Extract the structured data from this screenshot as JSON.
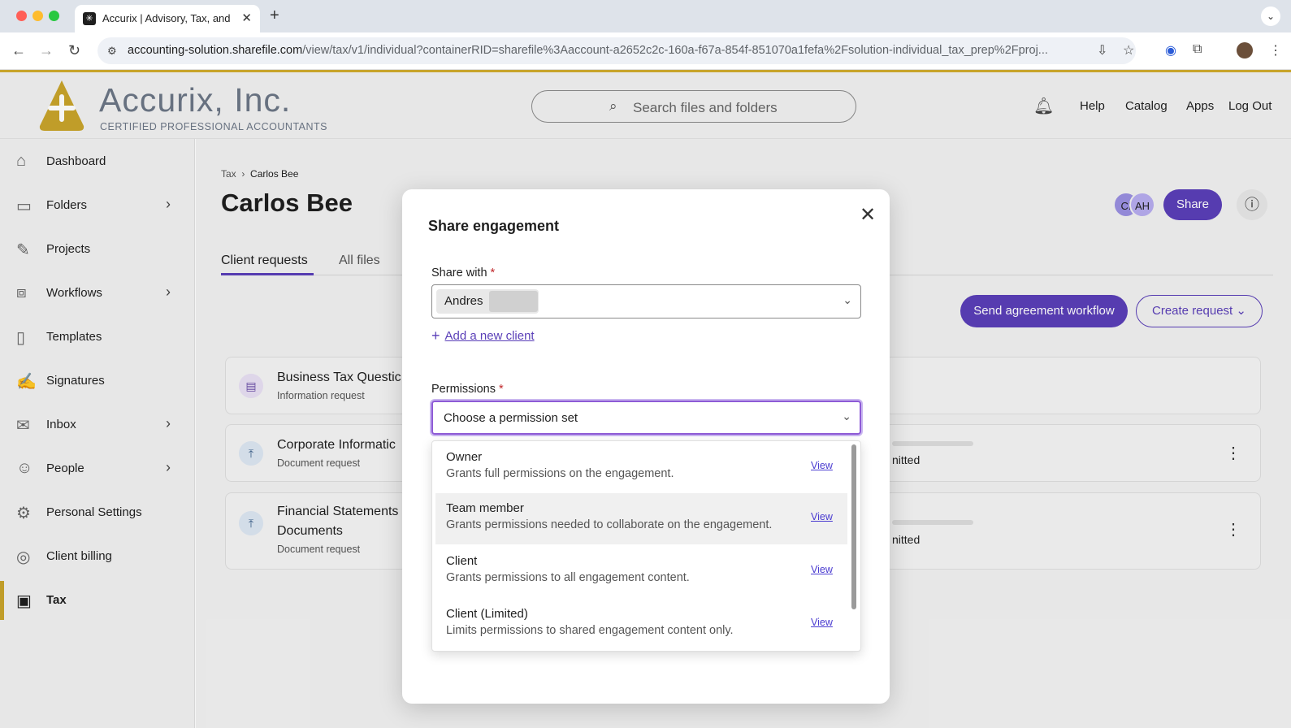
{
  "browser": {
    "tab_title": "Accurix | Advisory, Tax, and A",
    "url_host": "accounting-solution.sharefile.com",
    "url_path": "/view/tax/v1/individual?containerRID=sharefile%3Aaccount-a2652c2c-160a-f67a-854f-851070a1fefa%2Fsolution-individual_tax_prep%2Fproj..."
  },
  "header": {
    "brand_name": "Accurix, Inc.",
    "brand_tagline": "CERTIFIED PROFESSIONAL ACCOUNTANTS",
    "search_placeholder": "Search files and folders",
    "links": [
      "Help",
      "Catalog",
      "Apps",
      "Log Out"
    ]
  },
  "sidebar": {
    "items": [
      {
        "label": "Dashboard",
        "icon": "home-icon"
      },
      {
        "label": "Folders",
        "icon": "folder-icon"
      },
      {
        "label": "Projects",
        "icon": "projects-icon"
      },
      {
        "label": "Workflows",
        "icon": "workflows-icon"
      },
      {
        "label": "Templates",
        "icon": "templates-icon"
      },
      {
        "label": "Signatures",
        "icon": "signature-icon"
      },
      {
        "label": "Inbox",
        "icon": "inbox-icon"
      },
      {
        "label": "People",
        "icon": "people-icon"
      },
      {
        "label": "Personal Settings",
        "icon": "gear-icon"
      },
      {
        "label": "Client billing",
        "icon": "billing-icon"
      },
      {
        "label": "Tax",
        "icon": "tax-icon",
        "active": true
      }
    ]
  },
  "main": {
    "breadcrumb": [
      "Tax",
      "Carlos Bee"
    ],
    "title": "Carlos Bee",
    "tabs": [
      "Client requests",
      "All files"
    ],
    "avatars": [
      "CI",
      "AH"
    ],
    "share_label": "Share",
    "send_label": "Send agreement workflow",
    "create_label": "Create request",
    "requests": [
      {
        "title": "Business Tax Questic",
        "subtitle": "Information request",
        "status": ""
      },
      {
        "title": "Corporate Informatic",
        "subtitle": "Document request",
        "status": "nitted"
      },
      {
        "title": "Financial Statements",
        "title2": "Documents",
        "subtitle": "Document request",
        "status": "nitted"
      }
    ]
  },
  "modal": {
    "title": "Share engagement",
    "share_with_label": "Share with",
    "required_mark": "*",
    "share_with_value": "Andres",
    "add_client_label": "Add a new client",
    "permissions_label": "Permissions",
    "permissions_placeholder": "Choose a permission set",
    "options": [
      {
        "name": "Owner",
        "desc": "Grants full permissions on the engagement.",
        "view": "View"
      },
      {
        "name": "Team member",
        "desc": "Grants permissions needed to collaborate on the engagement.",
        "view": "View"
      },
      {
        "name": "Client",
        "desc": "Grants permissions to all engagement content.",
        "view": "View"
      },
      {
        "name": "Client (Limited)",
        "desc": "Limits permissions to shared engagement content only.",
        "view": "View"
      }
    ]
  },
  "colors": {
    "accent": "#5a3fb8",
    "gold": "#c8a42b"
  }
}
